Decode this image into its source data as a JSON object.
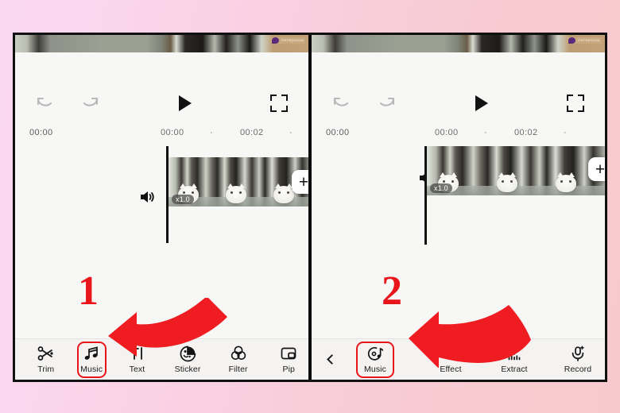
{
  "background": {
    "from": "#fbd8f2",
    "to": "#f8c9cc"
  },
  "accent_red": "#e8161a",
  "preview": {
    "watermark_text": "пятёрочка",
    "watermark_logo": "logo-badge-icon"
  },
  "controls": {
    "undo": "undo-icon",
    "redo": "redo-icon",
    "play": "play-icon",
    "fullscreen": "fullscreen-icon"
  },
  "ruler": {
    "start": "00:00",
    "tick1": "00:00",
    "dot1": "·",
    "tick2": "00:02",
    "dot2": "·"
  },
  "timeline": {
    "speed_badge": "x1.0",
    "add_label": "+",
    "volume_icon": "speaker-icon"
  },
  "panels": [
    {
      "id": "left",
      "step": "1",
      "toolbar": [
        {
          "label": "Trim",
          "icon": "scissors-icon",
          "selected": false
        },
        {
          "label": "Music",
          "icon": "music-notes-icon",
          "selected": true
        },
        {
          "label": "Text",
          "icon": "text-icon",
          "selected": false
        },
        {
          "label": "Sticker",
          "icon": "sticker-face-icon",
          "selected": false
        },
        {
          "label": "Filter",
          "icon": "filter-circles-icon",
          "selected": false
        },
        {
          "label": "Pip",
          "icon": "pip-icon",
          "selected": false
        }
      ]
    },
    {
      "id": "right",
      "step": "2",
      "back_icon": "back-chevron-icon",
      "toolbar": [
        {
          "label": "Music",
          "icon": "music-disc-icon",
          "selected": true
        },
        {
          "label": "Effect",
          "icon": "effect-icon",
          "selected": false
        },
        {
          "label": "Extract",
          "icon": "extract-arrow-icon",
          "selected": false
        },
        {
          "label": "Record",
          "icon": "microphone-icon",
          "selected": false
        }
      ]
    }
  ]
}
